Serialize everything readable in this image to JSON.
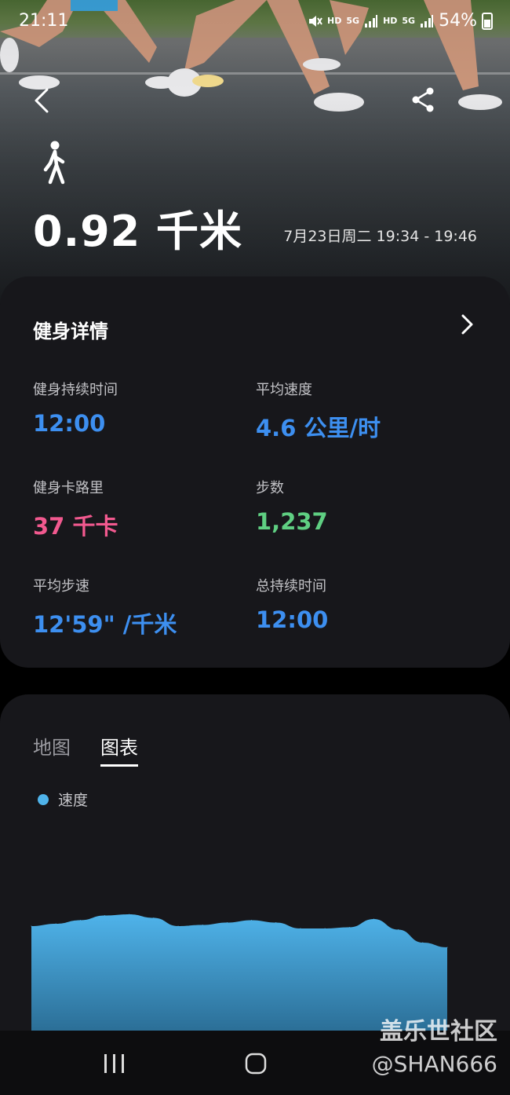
{
  "status_bar": {
    "time": "21:11",
    "signal_labels": [
      "HD",
      "5G",
      "HD",
      "5G"
    ],
    "battery": "54%"
  },
  "workout": {
    "distance": "0.92 千米",
    "date_range": "7月23日周二 19:34 - 19:46"
  },
  "details": {
    "title": "健身详情",
    "metrics": [
      {
        "label": "健身持续时间",
        "value": "12:00",
        "color": "#3d8ff0"
      },
      {
        "label": "平均速度",
        "value": "4.6 公里/时",
        "color": "#3d8ff0"
      },
      {
        "label": "健身卡路里",
        "value": "37 千卡",
        "color": "#f2598f"
      },
      {
        "label": "步数",
        "value": "1,237",
        "color": "#5fcf82"
      },
      {
        "label": "平均步速",
        "value": "12'59\" /千米",
        "color": "#3d8ff0"
      },
      {
        "label": "总持续时间",
        "value": "12:00",
        "color": "#3d8ff0"
      }
    ]
  },
  "chart_section": {
    "tabs": [
      {
        "label": "地图",
        "active": false
      },
      {
        "label": "图表",
        "active": true
      }
    ],
    "legend_label": "速度",
    "legend_color": "#4fb3ea"
  },
  "chart_data": {
    "type": "area",
    "series": [
      {
        "name": "速度",
        "values": [
          0.9,
          0.92,
          0.95,
          0.99,
          1.0,
          0.97,
          0.9,
          0.91,
          0.93,
          0.95,
          0.93,
          0.88,
          0.88,
          0.89,
          0.96,
          0.87,
          0.76,
          0.72
        ]
      }
    ],
    "note_units": "",
    "ylim": [
      0,
      1.0
    ],
    "grid": false
  },
  "watermark": {
    "line1": "盖乐世社区",
    "line2": "@SHAN666"
  },
  "icons": [
    "back-arrow-icon",
    "share-icon",
    "walk-icon",
    "chevron-right-icon",
    "recent-apps-icon",
    "home-icon"
  ]
}
